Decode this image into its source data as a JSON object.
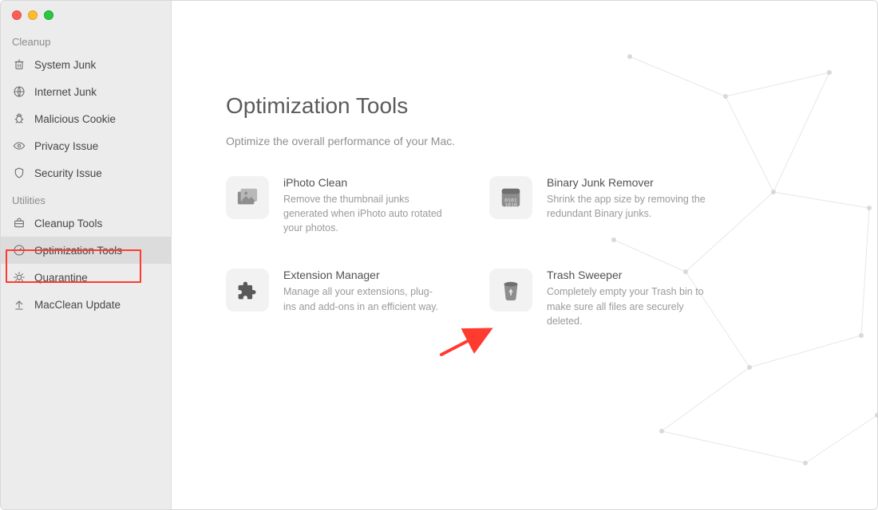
{
  "sidebar": {
    "sections": [
      {
        "label": "Cleanup",
        "items": [
          {
            "key": "system-junk",
            "label": "System Junk"
          },
          {
            "key": "internet-junk",
            "label": "Internet Junk"
          },
          {
            "key": "malicious-cookie",
            "label": "Malicious Cookie"
          },
          {
            "key": "privacy-issue",
            "label": "Privacy Issue"
          },
          {
            "key": "security-issue",
            "label": "Security Issue"
          }
        ]
      },
      {
        "label": "Utilities",
        "items": [
          {
            "key": "cleanup-tools",
            "label": "Cleanup Tools"
          },
          {
            "key": "optimization-tools",
            "label": "Optimization Tools",
            "selected": true
          },
          {
            "key": "quarantine",
            "label": "Quarantine"
          },
          {
            "key": "macclean-update",
            "label": "MacClean Update"
          }
        ]
      }
    ]
  },
  "main": {
    "title": "Optimization Tools",
    "subtitle": "Optimize the overall performance of your Mac.",
    "tools": [
      {
        "key": "iphoto-clean",
        "title": "iPhoto Clean",
        "desc": "Remove the thumbnail junks generated when iPhoto auto rotated your photos."
      },
      {
        "key": "binary-junk-remover",
        "title": "Binary Junk Remover",
        "desc": "Shrink the app size by removing the redundant Binary junks."
      },
      {
        "key": "extension-manager",
        "title": "Extension Manager",
        "desc": "Manage all your extensions, plug-ins and add-ons in an efficient way."
      },
      {
        "key": "trash-sweeper",
        "title": "Trash Sweeper",
        "desc": "Completely empty your Trash bin to make sure all files are securely deleted."
      }
    ]
  },
  "annotations": {
    "highlight_target": "optimization-tools",
    "arrow_points_to": "extension-manager"
  }
}
